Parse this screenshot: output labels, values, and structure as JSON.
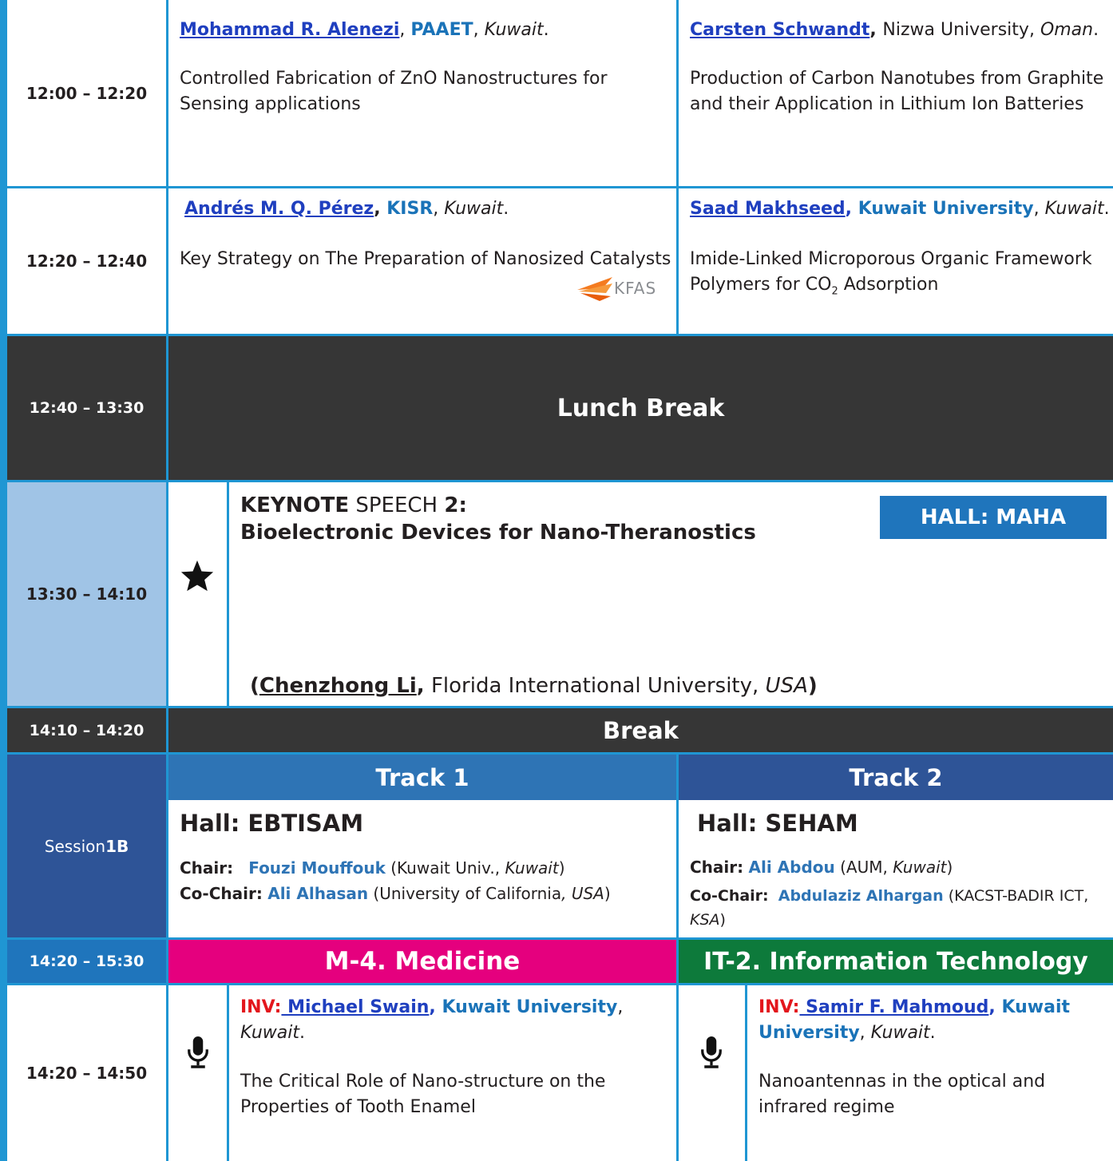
{
  "rows": [
    {
      "time": "12:00  – 12:20",
      "left": {
        "person": "Mohammad R. Alenezi",
        "sep": ", ",
        "org": "PAAET",
        "sep2": ", ",
        "country": "Kuwait",
        "end": ".",
        "title": "Controlled Fabrication of ZnO Nanostructures for Sensing applications"
      },
      "right": {
        "person": "Carsten Schwandt",
        "sep": ", ",
        "org": "Nizwa University",
        "sep2": ", ",
        "country": "Oman",
        "end": ".",
        "title": "Production of Carbon Nanotubes from Graphite and their Application in Lithium Ion Batteries"
      }
    },
    {
      "time": "12:20  – 12:40",
      "left": {
        "person": "Andrés M. Q. Pérez",
        "sep": ", ",
        "org": "KISR",
        "sep2": ", ",
        "country": "Kuwait",
        "end": ".",
        "title": "Key Strategy on The Preparation of Nanosized Catalysts",
        "logo": "KFAS"
      },
      "right": {
        "person": "Saad Makhseed",
        "sep": ", ",
        "org": "Kuwait University",
        "sep2": ", ",
        "country": "Kuwait",
        "end": ".",
        "title_a": "Imide-Linked Microporous Organic Framework Polymers for CO",
        "title_sub": "2",
        "title_b": " Adsorption"
      }
    }
  ],
  "lunch": {
    "time": "12:40  – 13:30",
    "label": "Lunch  Break"
  },
  "keynote": {
    "time": "13:30  – 14:10",
    "kw1": "KEYNOTE",
    "kw2": " SPEECH ",
    "kw3": "2:",
    "title": "Bioelectronic Devices for Nano-Theranostics",
    "hall": "HALL: MAHA",
    "open": "(",
    "speaker": "Chenzhong Li",
    "comma": ",",
    "affil": " Florida International University, ",
    "country": "USA",
    "close": ")",
    "icon": "star-icon"
  },
  "break": {
    "time": "14:10  – 14:20",
    "label": "Break"
  },
  "session": {
    "label": "Session ",
    "num": "1B",
    "track1": "Track 1",
    "track2": "Track 2",
    "hall1": "Hall: EBTISAM",
    "hall2": "Hall: SEHAM",
    "chair1": {
      "chair_label": "Chair:",
      "chair": "Fouzi Mouffouk",
      "chair_aff": " (Kuwait Univ., ",
      "chair_country": "Kuwait",
      "chair_end": ")",
      "co_label": "Co-Chair:",
      "co": "Ali Alhasan",
      "co_aff": " (University of California",
      "co_comma": ", ",
      "co_country": "USA",
      "co_end": ")"
    },
    "chair2": {
      "chair_label": "Chair:",
      "chair": "Ali Abdou",
      "chair_aff": "   (AUM, ",
      "chair_country": "Kuwait",
      "chair_end": ")",
      "co_label": "Co-Chair:",
      "co": "Abdulaziz Alhargan",
      "co_aff": " (KACST-BADIR ICT, ",
      "co_country": "KSA",
      "co_end": ")"
    }
  },
  "tracks_row": {
    "time": "14:20  – 15:30",
    "left": "M-4. Medicine",
    "right": "IT-2. Information Technology"
  },
  "inv_row": {
    "time": "14:20 –  14:50",
    "left": {
      "inv": "INV:",
      "person": " Michael Swain",
      "sep": ", ",
      "org": "Kuwait University",
      "sep2": ", ",
      "country": "Kuwait",
      "end": ".",
      "title": "The Critical Role of Nano-structure on the Properties of Tooth Enamel"
    },
    "right": {
      "inv": "INV:",
      "person": "  Samir F. Mahmoud",
      "sep": ", ",
      "org": "Kuwait University",
      "sep2": ", ",
      "country": "Kuwait",
      "end": ".",
      "title": "Nanoantennas in the optical and infrared regime"
    },
    "icon": "microphone-icon"
  },
  "colors": {
    "border": "#1f96d3",
    "dark": "#363636",
    "keynote_time": "#a0c4e6",
    "session": "#2e5497",
    "track1": "#2e74b5",
    "track2": "#2e5497",
    "medicine": "#e5007e",
    "it": "#0d7a3b",
    "hall_badge": "#1f75bc"
  }
}
